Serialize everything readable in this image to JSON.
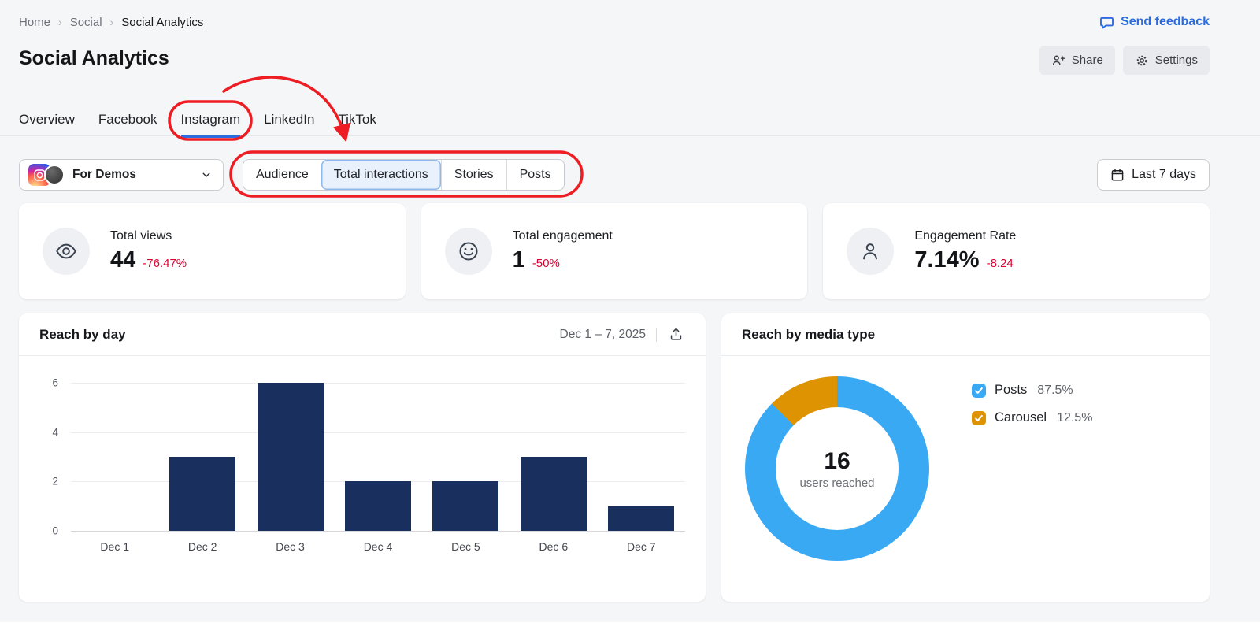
{
  "colors": {
    "accent_blue": "#2a6ce0",
    "negative_red": "#dd002e",
    "annotation_red": "#ee1d23",
    "bar_navy": "#19305f",
    "donut_blue": "#3aa9f4",
    "donut_orange": "#dd9302"
  },
  "breadcrumb": {
    "home": "Home",
    "social": "Social",
    "current": "Social Analytics"
  },
  "feedback_link": "Send feedback",
  "page": {
    "title": "Social Analytics"
  },
  "actions": {
    "share": "Share",
    "settings": "Settings"
  },
  "tabs": {
    "active": "Instagram",
    "items": [
      {
        "label": "Overview"
      },
      {
        "label": "Facebook"
      },
      {
        "label": "Instagram"
      },
      {
        "label": "LinkedIn"
      },
      {
        "label": "TikTok"
      }
    ]
  },
  "toolbar": {
    "profile_name": "For Demos",
    "segments": [
      {
        "label": "Audience",
        "selected": false
      },
      {
        "label": "Total interactions",
        "selected": true
      },
      {
        "label": "Stories",
        "selected": false
      },
      {
        "label": "Posts",
        "selected": false
      }
    ],
    "date_button": "Last 7 days"
  },
  "metrics": [
    {
      "icon": "eye-icon",
      "label": "Total views",
      "value": "44",
      "delta": "-76.47%"
    },
    {
      "icon": "smiley-icon",
      "label": "Total engagement",
      "value": "1",
      "delta": "-50%"
    },
    {
      "icon": "person-icon",
      "label": "Engagement Rate",
      "value": "7.14%",
      "delta": "-8.24"
    }
  ],
  "reach_by_day": {
    "title": "Reach by day",
    "date_range": "Dec 1 – 7, 2025"
  },
  "reach_by_media": {
    "title": "Reach by media type",
    "center_value": "16",
    "center_label": "users reached",
    "legend": [
      {
        "label": "Posts",
        "value": "87.5%"
      },
      {
        "label": "Carousel",
        "value": "12.5%"
      }
    ]
  },
  "chart_data": [
    {
      "type": "bar",
      "title": "Reach by day",
      "categories": [
        "Dec 1",
        "Dec 2",
        "Dec 3",
        "Dec 4",
        "Dec 5",
        "Dec 6",
        "Dec 7"
      ],
      "values": [
        0,
        3,
        6,
        2,
        2,
        3,
        1
      ],
      "xlabel": "",
      "ylabel": "",
      "ylim": [
        0,
        6
      ],
      "yticks": [
        6,
        4,
        2,
        0
      ],
      "grid": true,
      "bar_color": "#19305f"
    },
    {
      "type": "pie",
      "title": "Reach by media type",
      "labels": [
        "Posts",
        "Carousel"
      ],
      "values": [
        87.5,
        12.5
      ],
      "colors": [
        "#3aa9f4",
        "#dd9302"
      ],
      "center_value": "16",
      "center_label": "users reached",
      "legend_position": "right"
    }
  ]
}
